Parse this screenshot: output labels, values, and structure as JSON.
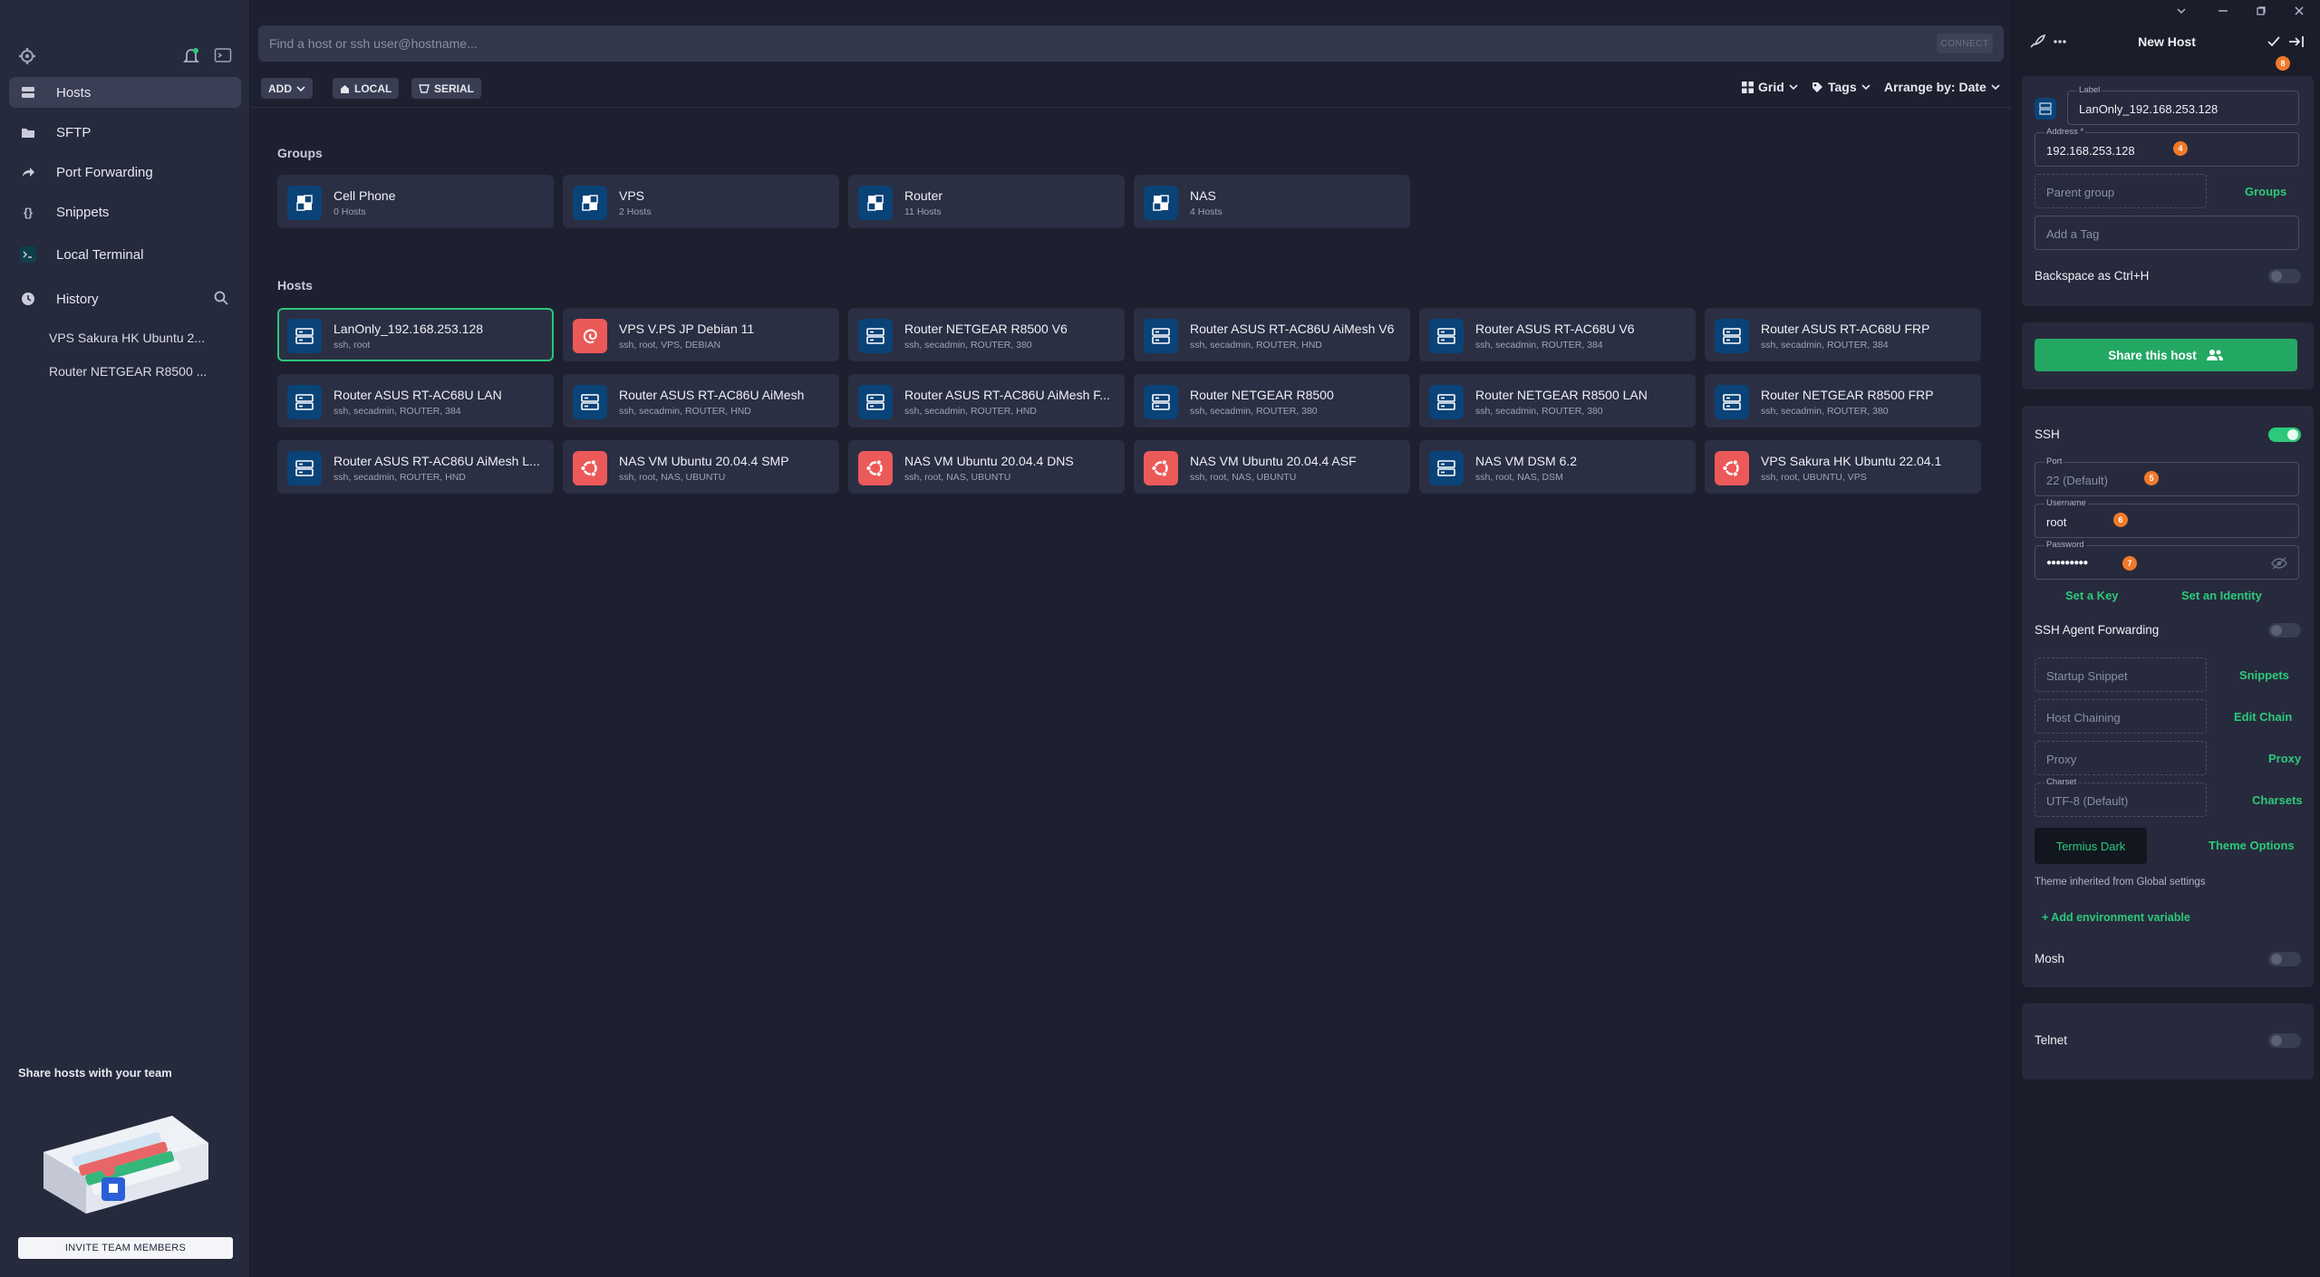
{
  "sidebar": {
    "nav": [
      {
        "label": "Hosts",
        "icon": "hosts-icon"
      },
      {
        "label": "SFTP",
        "icon": "folder-icon"
      },
      {
        "label": "Port Forwarding",
        "icon": "forward-arrow-icon"
      },
      {
        "label": "Snippets",
        "icon": "braces-icon"
      },
      {
        "label": "Local Terminal",
        "icon": "terminal-icon"
      }
    ],
    "history_label": "History",
    "history": [
      "VPS Sakura HK Ubuntu 2...",
      "Router NETGEAR R8500 ..."
    ],
    "promo_title": "Share hosts with your team",
    "invite_label": "INVITE TEAM MEMBERS"
  },
  "main": {
    "search_placeholder": "Find a host or ssh user@hostname...",
    "connect_label": "CONNECT",
    "toolbar": {
      "add": "ADD",
      "local": "LOCAL",
      "serial": "SERIAL",
      "grid": "Grid",
      "tags": "Tags",
      "arrange": "Arrange by: Date"
    },
    "groups_title": "Groups",
    "groups": [
      {
        "name": "Cell Phone",
        "count": "0 Hosts"
      },
      {
        "name": "VPS",
        "count": "2 Hosts"
      },
      {
        "name": "Router",
        "count": "11 Hosts"
      },
      {
        "name": "NAS",
        "count": "4 Hosts"
      }
    ],
    "hosts_title": "Hosts",
    "hosts": [
      {
        "name": "LanOnly_192.168.253.128",
        "sub": "ssh, root",
        "icon": "server",
        "selected": true
      },
      {
        "name": "VPS V.PS JP Debian 11",
        "sub": "ssh, root, VPS, DEBIAN",
        "icon": "debian"
      },
      {
        "name": "Router NETGEAR R8500 V6",
        "sub": "ssh, secadmin, ROUTER, 380",
        "icon": "server"
      },
      {
        "name": "Router ASUS RT-AC86U AiMesh V6",
        "sub": "ssh, secadmin, ROUTER, HND",
        "icon": "server"
      },
      {
        "name": "Router ASUS RT-AC68U V6",
        "sub": "ssh, secadmin, ROUTER, 384",
        "icon": "server"
      },
      {
        "name": "Router ASUS RT-AC68U FRP",
        "sub": "ssh, secadmin, ROUTER, 384",
        "icon": "server"
      },
      {
        "name": "Router ASUS RT-AC68U LAN",
        "sub": "ssh, secadmin, ROUTER, 384",
        "icon": "server"
      },
      {
        "name": "Router ASUS RT-AC86U AiMesh",
        "sub": "ssh, secadmin, ROUTER, HND",
        "icon": "server"
      },
      {
        "name": "Router ASUS RT-AC86U AiMesh F...",
        "sub": "ssh, secadmin, ROUTER, HND",
        "icon": "server"
      },
      {
        "name": "Router NETGEAR R8500",
        "sub": "ssh, secadmin, ROUTER, 380",
        "icon": "server"
      },
      {
        "name": "Router NETGEAR R8500 LAN",
        "sub": "ssh, secadmin, ROUTER, 380",
        "icon": "server"
      },
      {
        "name": "Router NETGEAR R8500 FRP",
        "sub": "ssh, secadmin, ROUTER, 380",
        "icon": "server"
      },
      {
        "name": "Router ASUS RT-AC86U AiMesh L...",
        "sub": "ssh, secadmin, ROUTER, HND",
        "icon": "server"
      },
      {
        "name": "NAS VM Ubuntu 20.04.4 SMP",
        "sub": "ssh, root, NAS, UBUNTU",
        "icon": "ubuntu"
      },
      {
        "name": "NAS VM Ubuntu 20.04.4 DNS",
        "sub": "ssh, root, NAS, UBUNTU",
        "icon": "ubuntu"
      },
      {
        "name": "NAS VM Ubuntu 20.04.4 ASF",
        "sub": "ssh, root, NAS, UBUNTU",
        "icon": "ubuntu"
      },
      {
        "name": "NAS VM DSM 6.2",
        "sub": "ssh, root, NAS, DSM",
        "icon": "server"
      },
      {
        "name": "VPS Sakura HK Ubuntu 22.04.1",
        "sub": "ssh, root, UBUNTU, VPS",
        "icon": "ubuntu"
      }
    ]
  },
  "panel": {
    "title": "New Host",
    "label_caption": "Label",
    "label_value": "LanOnly_192.168.253.128",
    "address_caption": "Address *",
    "address_value": "192.168.253.128",
    "parent_group_placeholder": "Parent group",
    "groups_link": "Groups",
    "tag_placeholder": "Add a Tag",
    "backspace_label": "Backspace as Ctrl+H",
    "share_label": "Share this host",
    "ssh_label": "SSH",
    "port_caption": "Port",
    "port_value": "22 (Default)",
    "username_caption": "Username",
    "username_value": "root",
    "password_caption": "Password",
    "password_value": "●●●●●●●●●",
    "set_key": "Set a Key",
    "set_identity": "Set an Identity",
    "agent_forwarding": "SSH Agent Forwarding",
    "startup_snippet": "Startup Snippet",
    "snippets_link": "Snippets",
    "host_chaining": "Host Chaining",
    "edit_chain": "Edit Chain",
    "proxy": "Proxy",
    "proxy_link": "Proxy",
    "charset_caption": "Charset",
    "charset_value": "UTF-8 (Default)",
    "charsets_link": "Charsets",
    "theme_value": "Termius Dark",
    "theme_options": "Theme Options",
    "theme_note": "Theme inherited from Global settings",
    "add_env": "+ Add environment variable",
    "mosh_label": "Mosh",
    "telnet_label": "Telnet",
    "badges": [
      "8",
      "4",
      "5",
      "6",
      "7"
    ]
  },
  "colors": {
    "accent_green": "#2cc97c",
    "badge_orange": "#f07a2a",
    "server_icon_bg": "#0a4378",
    "linux_icon_bg": "#ec5959"
  }
}
